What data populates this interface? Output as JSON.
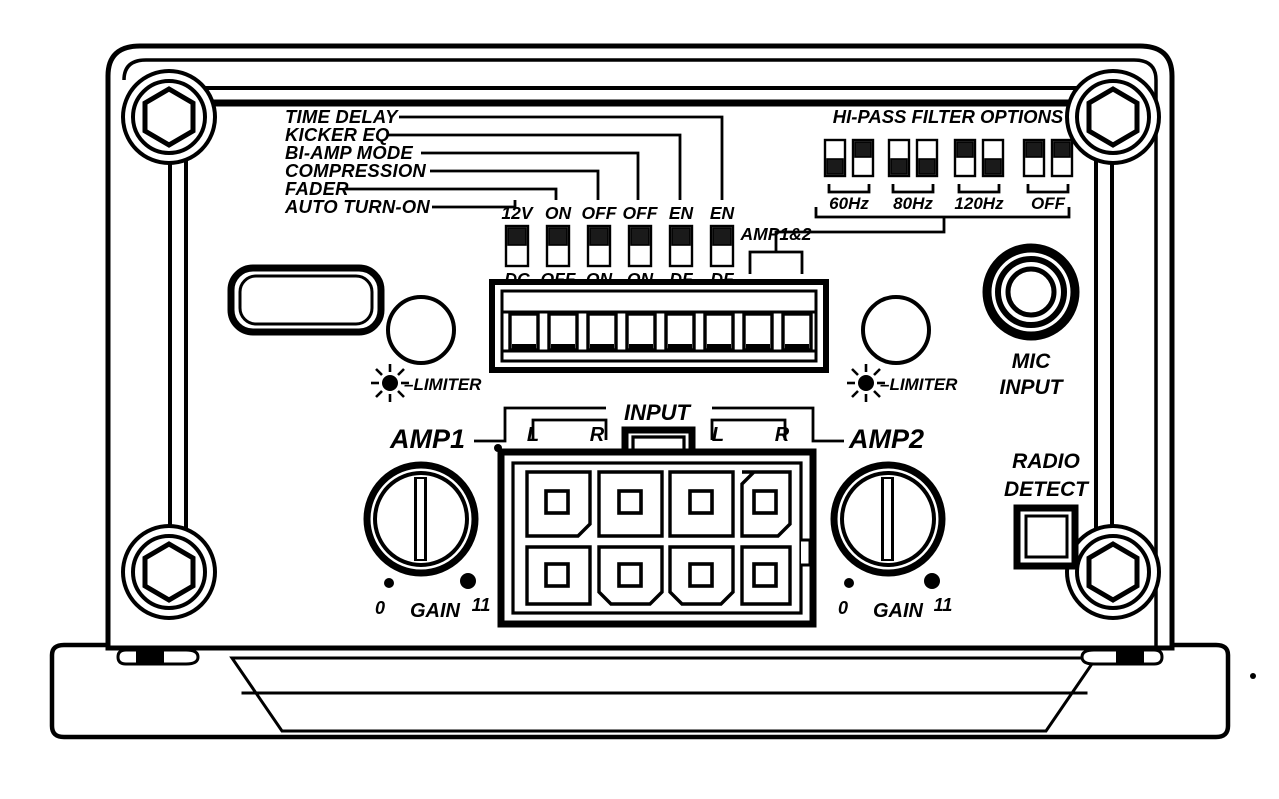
{
  "device": {
    "type": "car-amplifier-faceplate-diagram",
    "ink": "#000000",
    "background": "#ffffff"
  },
  "feature_labels": {
    "items": [
      {
        "name": "time-delay",
        "text": "TIME DELAY"
      },
      {
        "name": "kicker-eq",
        "text": "KICKER EQ"
      },
      {
        "name": "bi-amp-mode",
        "text": "BI-AMP MODE"
      },
      {
        "name": "compression",
        "text": "COMPRESSION"
      },
      {
        "name": "fader",
        "text": "FADER"
      },
      {
        "name": "auto-turn-on",
        "text": "AUTO TURN-ON"
      }
    ]
  },
  "config_switches": {
    "position": "up",
    "items": [
      {
        "name": "auto-turn-on-switch",
        "top": "12V",
        "bottom": "DC",
        "state": "up"
      },
      {
        "name": "fader-switch",
        "top": "ON",
        "bottom": "OFF",
        "state": "up"
      },
      {
        "name": "compression-switch",
        "top": "OFF",
        "bottom": "ON",
        "state": "up"
      },
      {
        "name": "bi-amp-mode-switch",
        "top": "OFF",
        "bottom": "ON",
        "state": "up"
      },
      {
        "name": "kicker-eq-switch",
        "top": "EN",
        "bottom": "DF",
        "state": "up"
      },
      {
        "name": "time-delay-switch",
        "top": "EN",
        "bottom": "DF",
        "state": "up"
      }
    ]
  },
  "hipass": {
    "title": "HI-PASS FILTER OPTIONS",
    "group_label": "AMP1&2",
    "options": [
      {
        "name": "hipass-60hz",
        "label": "60Hz",
        "switches": [
          "down",
          "up"
        ]
      },
      {
        "name": "hipass-80hz",
        "label": "80Hz",
        "switches": [
          "down",
          "down"
        ]
      },
      {
        "name": "hipass-120hz",
        "label": "120Hz",
        "switches": [
          "up",
          "down"
        ]
      },
      {
        "name": "hipass-off",
        "label": "OFF",
        "switches": [
          "up",
          "up"
        ]
      }
    ]
  },
  "terminal_block": {
    "name": "speaker-terminal-block",
    "slots": 8
  },
  "amp1": {
    "label": "AMP1",
    "limiter_label": "–LIMITER",
    "gain_label": "GAIN",
    "gain_min": "0",
    "gain_max": "11",
    "channels": [
      "L",
      "R"
    ]
  },
  "amp2": {
    "label": "AMP2",
    "limiter_label": "–LIMITER",
    "gain_label": "GAIN",
    "gain_min": "0",
    "gain_max": "11",
    "channels": [
      "L",
      "R"
    ]
  },
  "input_connector": {
    "label": "INPUT",
    "name": "input-harness-connector",
    "pins": 8,
    "rows": 2,
    "columns": 4
  },
  "mic": {
    "line1": "MIC",
    "line2": "INPUT"
  },
  "radio_detect": {
    "line1": "RADIO",
    "line2": "DETECT"
  }
}
